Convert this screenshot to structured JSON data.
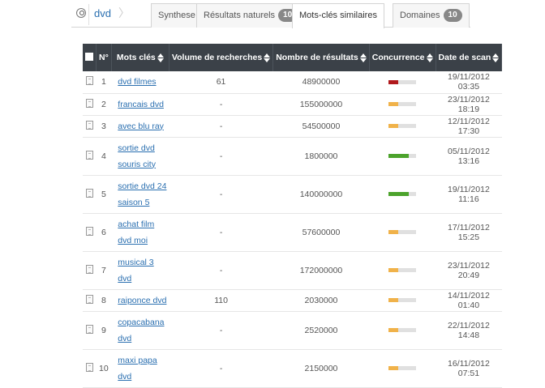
{
  "breadcrumb": {
    "keyword": "dvd"
  },
  "tabs": [
    {
      "label": "Synthese",
      "badge": ""
    },
    {
      "label": "Résultats naturels",
      "badge": "10"
    },
    {
      "label": "Mots-clés similaires",
      "badge": ""
    },
    {
      "label": "Domaines",
      "badge": "10"
    }
  ],
  "columns": [
    "N°",
    "Mots clés",
    "Volume de recherches",
    "Nombre de résultats",
    "Concurrence",
    "Date de scan"
  ],
  "colors": {
    "low": "#f0b24a",
    "mid": "#4ca32c",
    "high": "#b0191c",
    "header": "#3b4148"
  },
  "rows": [
    {
      "n": "1",
      "kw1": "dvd filmes",
      "kw2": "",
      "volume": "61",
      "results": "48900000",
      "concurrence": 0.36,
      "level": "high",
      "date": "19/11/2012 03:35"
    },
    {
      "n": "2",
      "kw1": "francais dvd",
      "kw2": "",
      "volume": "-",
      "results": "155000000",
      "concurrence": 0.36,
      "level": "low",
      "date": "23/11/2012 18:19"
    },
    {
      "n": "3",
      "kw1": "avec blu ray",
      "kw2": "",
      "volume": "-",
      "results": "54500000",
      "concurrence": 0.36,
      "level": "low",
      "date": "12/11/2012 17:30"
    },
    {
      "n": "4",
      "kw1": "sortie dvd",
      "kw2": "souris city",
      "volume": "-",
      "results": "1800000",
      "concurrence": 0.72,
      "level": "mid",
      "date": "05/11/2012 13:16"
    },
    {
      "n": "5",
      "kw1": "sortie dvd 24",
      "kw2": "saison 5",
      "volume": "-",
      "results": "140000000",
      "concurrence": 0.72,
      "level": "mid",
      "date": "19/11/2012 11:16"
    },
    {
      "n": "6",
      "kw1": "achat film",
      "kw2": "dvd moi",
      "volume": "-",
      "results": "57600000",
      "concurrence": 0.36,
      "level": "low",
      "date": "17/11/2012 15:25"
    },
    {
      "n": "7",
      "kw1": "musical 3",
      "kw2": "dvd",
      "volume": "-",
      "results": "172000000",
      "concurrence": 0.36,
      "level": "low",
      "date": "23/11/2012 20:49"
    },
    {
      "n": "8",
      "kw1": "raiponce dvd",
      "kw2": "",
      "volume": "110",
      "results": "2030000",
      "concurrence": 0.36,
      "level": "low",
      "date": "14/11/2012 01:40"
    },
    {
      "n": "9",
      "kw1": "copacabana",
      "kw2": "dvd",
      "volume": "-",
      "results": "2520000",
      "concurrence": 0.36,
      "level": "low",
      "date": "22/11/2012 14:48"
    },
    {
      "n": "10",
      "kw1": "maxi papa",
      "kw2": "dvd",
      "volume": "-",
      "results": "2150000",
      "concurrence": 0.36,
      "level": "low",
      "date": "16/11/2012 07:51"
    }
  ]
}
